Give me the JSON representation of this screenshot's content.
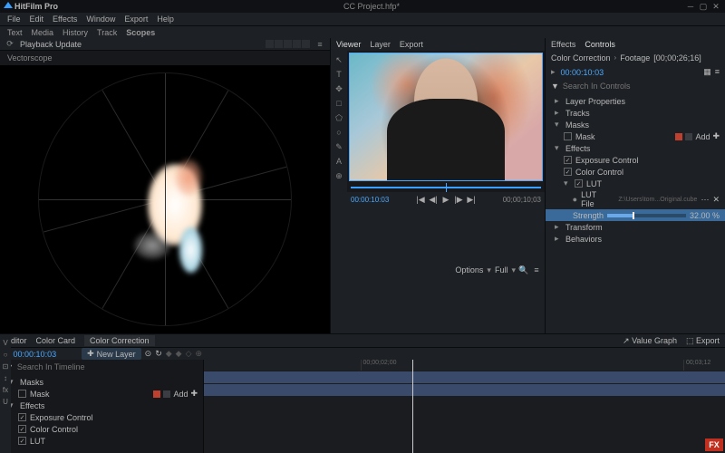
{
  "app": {
    "name": "HitFilm Pro",
    "project": "CC Project.hfp*"
  },
  "menu": [
    "File",
    "Edit",
    "Effects",
    "Window",
    "Export",
    "Help"
  ],
  "tool_tabs": [
    "Text",
    "Media",
    "History",
    "Track",
    "Scopes"
  ],
  "playback_panel": {
    "label": "Playback Update",
    "scope": "Vectorscope"
  },
  "viewer": {
    "tabs": [
      "Viewer",
      "Layer",
      "Export"
    ],
    "tc_left": "00:00:10:03",
    "tc_right": "00;00;10;03",
    "options": "Options",
    "full": "Full",
    "tools": [
      "↖",
      "T",
      "✥",
      "□",
      "⬠",
      "○",
      "✎",
      "A",
      "⊕"
    ]
  },
  "controls": {
    "tabs": [
      "Effects",
      "Controls"
    ],
    "breadcrumb": [
      "Color Correction",
      "Footage",
      "[00;00;26;16]"
    ],
    "timecode": "00:00:10:03",
    "search_ph": "Search In Controls",
    "tree": [
      {
        "label": "Layer Properties",
        "type": "head"
      },
      {
        "label": "Tracks",
        "type": "head"
      },
      {
        "label": "Masks",
        "type": "group",
        "open": true
      },
      {
        "label": "Mask",
        "type": "item",
        "indent": 1,
        "chk": false,
        "add": "Add"
      },
      {
        "label": "Effects",
        "type": "group",
        "open": true
      },
      {
        "label": "Exposure Control",
        "type": "item",
        "indent": 1,
        "chk": true
      },
      {
        "label": "Color Control",
        "type": "item",
        "indent": 1,
        "chk": true
      },
      {
        "label": "LUT",
        "type": "group",
        "open": true,
        "indent": 1,
        "chk": true
      },
      {
        "label": "LUT File",
        "type": "file",
        "indent": 2,
        "value": "Z:\\Users\\tom...Original.cube"
      },
      {
        "label": "Strength",
        "type": "slider",
        "indent": 2,
        "value": 32.0,
        "unit": "%"
      },
      {
        "label": "Transform",
        "type": "head"
      },
      {
        "label": "Behaviors",
        "type": "head"
      }
    ]
  },
  "editor": {
    "tabs": [
      "Editor",
      "Color Card",
      "Color Correction"
    ],
    "active": 2,
    "tc": "00:00:10:03",
    "new_layer": "New Layer",
    "search_ph": "Search In Timeline",
    "value_graph": "Value Graph",
    "export": "Export",
    "tree": [
      {
        "label": "Masks",
        "type": "group",
        "open": true
      },
      {
        "label": "Mask",
        "type": "item",
        "indent": 1,
        "chk": false,
        "add": "Add"
      },
      {
        "label": "Effects",
        "type": "group",
        "open": true
      },
      {
        "label": "Exposure Control",
        "type": "item",
        "indent": 1,
        "chk": true
      },
      {
        "label": "Color Control",
        "type": "item",
        "indent": 1,
        "chk": true
      },
      {
        "label": "LUT",
        "type": "item",
        "indent": 1,
        "chk": true
      }
    ],
    "ruler": [
      "00;00;02;00",
      "00;03;12"
    ]
  },
  "vside": [
    "V",
    "○",
    "⊡",
    "↕",
    "fx",
    "U"
  ],
  "fx_badge": "FX"
}
